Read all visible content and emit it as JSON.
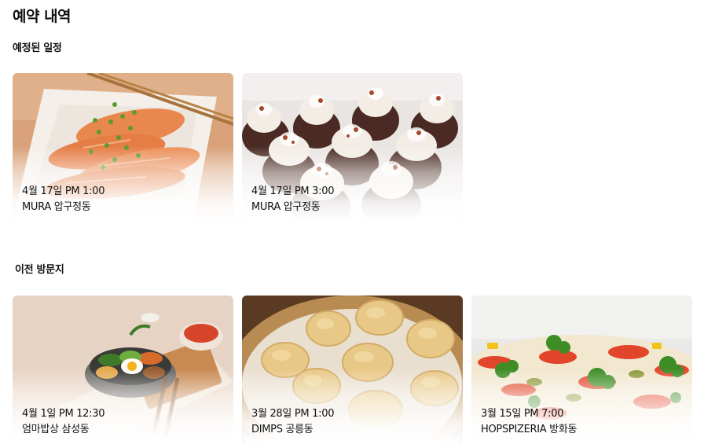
{
  "page_title": "예약 내역",
  "upcoming": {
    "title": "예정된 일정",
    "cards": [
      {
        "date": "4월 17일 PM 1:00",
        "place": "MURA 압구정동",
        "image_icon": "salmon-dish-image"
      },
      {
        "date": "4월 17일 PM 3:00",
        "place": "MURA 압구정동",
        "image_icon": "cupcakes-image"
      }
    ]
  },
  "past": {
    "title": "이전 방문지",
    "cards": [
      {
        "date": "4월 1일 PM 12:30",
        "place": "엄마밥상 삼성동",
        "image_icon": "bibimbap-image"
      },
      {
        "date": "3월 28일 PM 1:00",
        "place": "DIMPS 공릉동",
        "image_icon": "dumplings-image"
      },
      {
        "date": "3월 15일 PM 7:00",
        "place": "HOPSPIZERIA 방화동",
        "image_icon": "pizza-image"
      }
    ]
  }
}
